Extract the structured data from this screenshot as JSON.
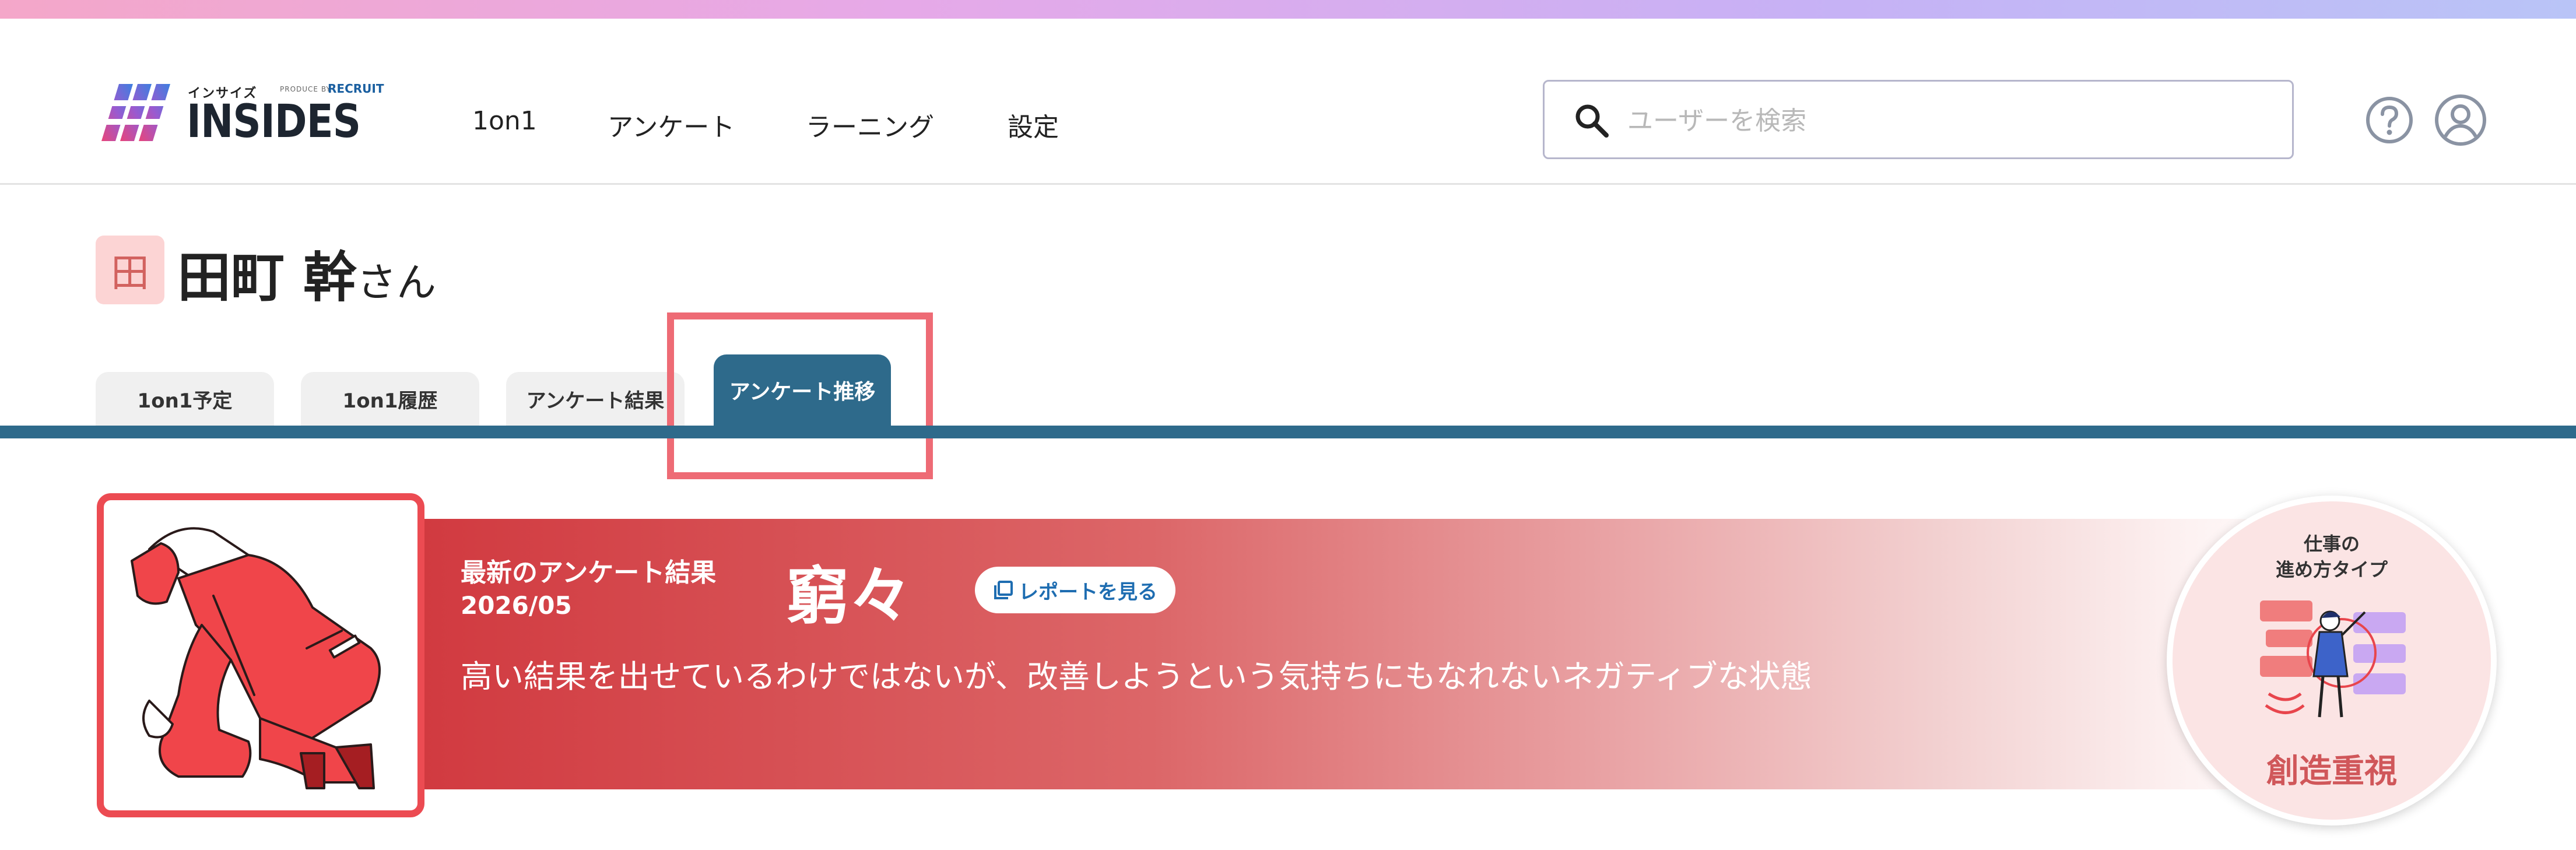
{
  "header": {
    "logo": {
      "small_text": "インサイズ",
      "produce_text": "PRODUCE BY",
      "recruit_text": "RECRUIT",
      "brand": "INSIDES"
    },
    "nav": [
      {
        "label": "1on1"
      },
      {
        "label": "アンケート"
      },
      {
        "label": "ラーニング"
      },
      {
        "label": "設定"
      }
    ],
    "search": {
      "placeholder": "ユーザーを検索",
      "value": ""
    }
  },
  "user": {
    "avatar_char": "田",
    "name": "田町 幹",
    "suffix": "さん"
  },
  "tabs": [
    {
      "label": "1on1予定",
      "active": false
    },
    {
      "label": "1on1履歴",
      "active": false
    },
    {
      "label": "アンケート結果",
      "active": false
    },
    {
      "label": "アンケート推移",
      "active": true
    }
  ],
  "result": {
    "latest_label": "最新のアンケート結果",
    "date": "2026/05",
    "title": "窮々",
    "report_button": "レポートを見る",
    "description": "高い結果を出せているわけではないが、改善しようという気持ちにもなれないネガティブな状態"
  },
  "work_type": {
    "label_line1": "仕事の",
    "label_line2": "進め方タイプ",
    "name": "創造重視"
  },
  "colors": {
    "accent": "#2e6a8b",
    "highlight": "#ee6b75",
    "banner_red": "#d13a40"
  }
}
